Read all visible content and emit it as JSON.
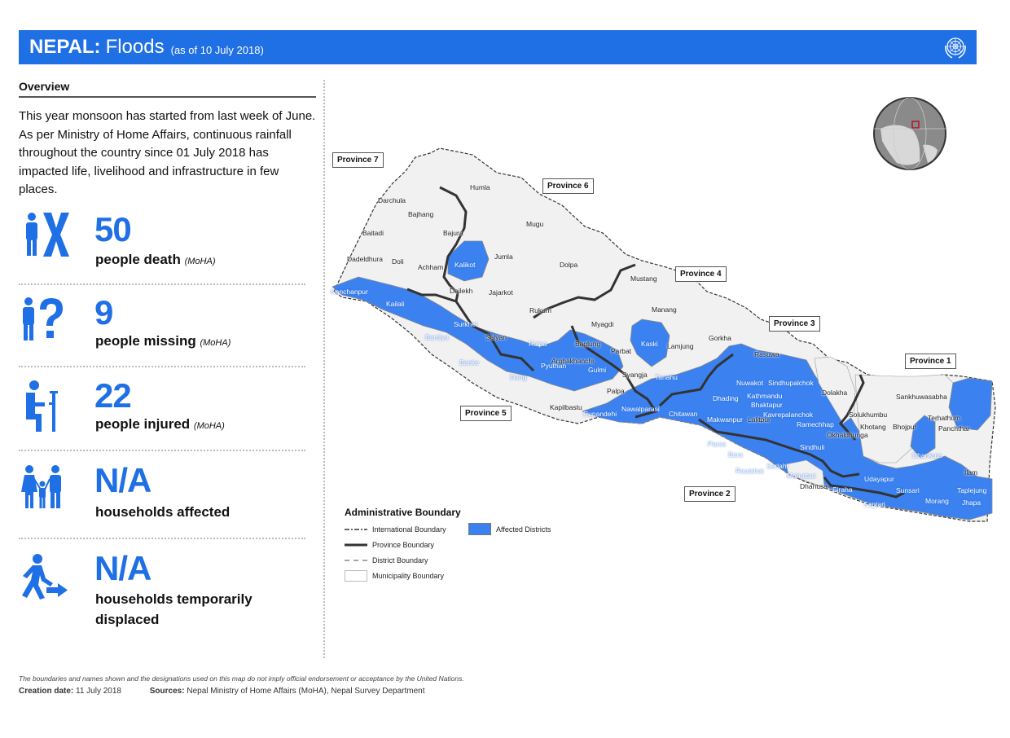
{
  "header": {
    "country": "NEPAL:",
    "event": "Floods",
    "as_of": "(as of 10 July 2018)",
    "logo": "un-emblem-icon"
  },
  "overview": {
    "title": "Overview",
    "text": "This year monsoon has started from last week of June. As per Ministry of Home Affairs, continuous rainfall throughout the country since 01 July 2018 has impacted life, livelihood and infrastructure in few places."
  },
  "stats": [
    {
      "icon": "person-dead-icon",
      "value": "50",
      "label": "people death",
      "source": "(MoHA)"
    },
    {
      "icon": "person-missing-icon",
      "value": "9",
      "label": "people missing",
      "source": "(MoHA)"
    },
    {
      "icon": "person-injured-icon",
      "value": "22",
      "label": "people injured",
      "source": "(MoHA)"
    },
    {
      "icon": "family-icon",
      "value": "N/A",
      "label": "households affected",
      "source": ""
    },
    {
      "icon": "displaced-person-icon",
      "value": "N/A",
      "label": "households temporarily displaced",
      "source": ""
    }
  ],
  "map": {
    "provinces": [
      "Province 7",
      "Province 6",
      "Province 5",
      "Province 4",
      "Province 3",
      "Province 2",
      "Province 1"
    ],
    "districts_unaffected": [
      "Humla",
      "Darchula",
      "Bajhang",
      "Mugu",
      "Baitadi",
      "Bajura",
      "Jumla",
      "Dadeldhura",
      "Doli",
      "Achham",
      "Dolpa",
      "Dailekh",
      "Jajarkot",
      "Mustang",
      "Rukum",
      "Manang",
      "Salyan",
      "Myagdi",
      "Gorkha",
      "Baglung",
      "Lamjung",
      "Parbat",
      "Rasuwa",
      "Arghakhanchi",
      "Syangja",
      "Palpa",
      "Kapilbastu",
      "Dolakha",
      "Solukhumbu",
      "Sankhuwasabha",
      "Okhaldhunga",
      "Khotang",
      "Bhojpur",
      "Terhathum",
      "Panchthar",
      "Dhanusa",
      "Ilam",
      "Lalitpur"
    ],
    "districts_affected": [
      "Kalikot",
      "Kanchanpur",
      "Kailali",
      "Surkhet",
      "Bardiya",
      "Banke",
      "Dang",
      "Rolpa",
      "Pyuthan",
      "Gulmi",
      "Kaski",
      "Tanahu",
      "Rupandehi",
      "Nawalparasi",
      "Chitawan",
      "Nuwakot",
      "Sindhupalchok",
      "Dhading",
      "Kathmandu",
      "Bhaktapur",
      "Kavrepalanchok",
      "Makwanpur",
      "Ramechhap",
      "Sindhuli",
      "Parsa",
      "Bara",
      "Rautahat",
      "Sarlahi",
      "Mahottari",
      "Siraha",
      "Saptari",
      "Udayapur",
      "Sunsari",
      "Morang",
      "Jhapa",
      "Dhankuta",
      "Taplejung"
    ],
    "affected_color": "#3b82f0"
  },
  "legend": {
    "title": "Administrative Boundary",
    "items": [
      "International Boundary",
      "Province Boundary",
      "District Boundary",
      "Municipality Boundary"
    ],
    "affected": "Affected Districts"
  },
  "inset": {
    "icon": "globe-locator-icon"
  },
  "footer": {
    "disclaimer": "The boundaries and names shown and the designations used on this map do not imply official endorsement or acceptance by the United Nations.",
    "creation_label": "Creation date:",
    "creation_value": "11 July 2018",
    "sources_label": "Sources:",
    "sources_value": "Nepal Ministry of Home Affairs (MoHA),  Nepal Survey Department"
  }
}
